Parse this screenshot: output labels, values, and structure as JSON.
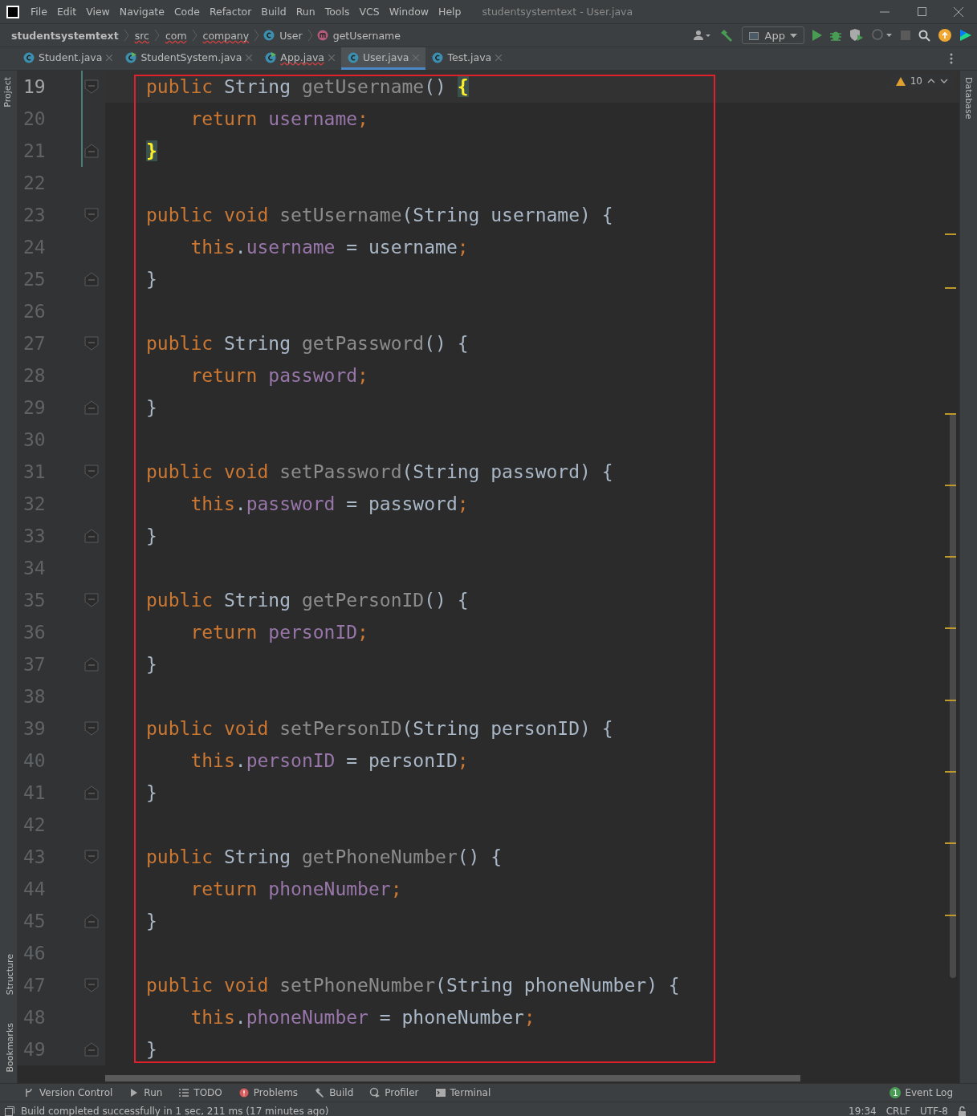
{
  "window": {
    "title": "studentsystemtext - User.java"
  },
  "menu": [
    "File",
    "Edit",
    "View",
    "Navigate",
    "Code",
    "Refactor",
    "Build",
    "Run",
    "Tools",
    "VCS",
    "Window",
    "Help"
  ],
  "breadcrumbs": [
    {
      "label": "studentsystemtext",
      "kind": "project",
      "spelling_error": false
    },
    {
      "label": "src",
      "kind": "folder",
      "spelling_error": true
    },
    {
      "label": "com",
      "kind": "folder",
      "spelling_error": true
    },
    {
      "label": "company",
      "kind": "folder",
      "spelling_error": true
    },
    {
      "label": "User",
      "kind": "class",
      "spelling_error": false
    },
    {
      "label": "getUsername",
      "kind": "method",
      "spelling_error": false
    }
  ],
  "run_config": "App",
  "tabs": [
    {
      "label": "Student.java",
      "runnable": false,
      "selected": false,
      "spelling_error": false
    },
    {
      "label": "StudentSystem.java",
      "runnable": true,
      "selected": false,
      "spelling_error": false
    },
    {
      "label": "App.java",
      "runnable": true,
      "selected": false,
      "spelling_error": true
    },
    {
      "label": "User.java",
      "runnable": false,
      "selected": true,
      "spelling_error": false
    },
    {
      "label": "Test.java",
      "runnable": false,
      "selected": false,
      "spelling_error": false
    }
  ],
  "left_tool_windows_top": [
    "Project"
  ],
  "left_tool_windows_bottom": [
    "Structure",
    "Bookmarks"
  ],
  "right_tool_windows": [
    "Database"
  ],
  "inspections": {
    "warnings": "10"
  },
  "editor": {
    "lines": [
      {
        "number": "19",
        "current": true,
        "changed": true,
        "kind": "fold-start",
        "tokens": [
          {
            "text": "public",
            "kind": "keyword"
          },
          {
            "text": " String ",
            "kind": "plain"
          },
          {
            "text": "getUsername",
            "kind": "unused"
          },
          {
            "text": "() ",
            "kind": "plain"
          },
          {
            "text": "{",
            "kind": "match"
          }
        ]
      },
      {
        "number": "20",
        "current": false,
        "changed": true,
        "kind": "body",
        "tokens": [
          {
            "text": "    return ",
            "kind": "keyword"
          },
          {
            "text": "username",
            "kind": "field"
          },
          {
            "text": ";",
            "kind": "keyword"
          }
        ]
      },
      {
        "number": "21",
        "current": false,
        "changed": true,
        "kind": "fold-end",
        "tokens": [
          {
            "text": "}",
            "kind": "match"
          }
        ]
      },
      {
        "number": "22",
        "current": false,
        "changed": false,
        "kind": "body"
      },
      {
        "number": "23",
        "current": false,
        "changed": false,
        "kind": "fold-start",
        "tokens": [
          {
            "text": "public void ",
            "kind": "keyword"
          },
          {
            "text": "setUsername",
            "kind": "unused"
          },
          {
            "text": "(String username) {",
            "kind": "plain"
          }
        ]
      },
      {
        "number": "24",
        "current": false,
        "changed": false,
        "kind": "body",
        "tokens": [
          {
            "text": "    this",
            "kind": "keyword"
          },
          {
            "text": ".",
            "kind": "plain"
          },
          {
            "text": "username",
            "kind": "field"
          },
          {
            "text": " = username",
            "kind": "plain"
          },
          {
            "text": ";",
            "kind": "keyword"
          }
        ]
      },
      {
        "number": "25",
        "current": false,
        "changed": false,
        "kind": "fold-end",
        "tokens": [
          {
            "text": "}",
            "kind": "plain"
          }
        ]
      },
      {
        "number": "26",
        "current": false,
        "changed": false,
        "kind": "body"
      },
      {
        "number": "27",
        "current": false,
        "changed": false,
        "kind": "fold-start",
        "tokens": [
          {
            "text": "public",
            "kind": "keyword"
          },
          {
            "text": " String ",
            "kind": "plain"
          },
          {
            "text": "getPassword",
            "kind": "unused"
          },
          {
            "text": "() {",
            "kind": "plain"
          }
        ]
      },
      {
        "number": "28",
        "current": false,
        "changed": false,
        "kind": "body",
        "tokens": [
          {
            "text": "    return ",
            "kind": "keyword"
          },
          {
            "text": "password",
            "kind": "field"
          },
          {
            "text": ";",
            "kind": "keyword"
          }
        ]
      },
      {
        "number": "29",
        "current": false,
        "changed": false,
        "kind": "fold-end",
        "tokens": [
          {
            "text": "}",
            "kind": "plain"
          }
        ]
      },
      {
        "number": "30",
        "current": false,
        "changed": false,
        "kind": "body"
      },
      {
        "number": "31",
        "current": false,
        "changed": false,
        "kind": "fold-start",
        "tokens": [
          {
            "text": "public void ",
            "kind": "keyword"
          },
          {
            "text": "setPassword",
            "kind": "unused"
          },
          {
            "text": "(String password) {",
            "kind": "plain"
          }
        ]
      },
      {
        "number": "32",
        "current": false,
        "changed": false,
        "kind": "body",
        "tokens": [
          {
            "text": "    this",
            "kind": "keyword"
          },
          {
            "text": ".",
            "kind": "plain"
          },
          {
            "text": "password",
            "kind": "field"
          },
          {
            "text": " = password",
            "kind": "plain"
          },
          {
            "text": ";",
            "kind": "keyword"
          }
        ]
      },
      {
        "number": "33",
        "current": false,
        "changed": false,
        "kind": "fold-end",
        "tokens": [
          {
            "text": "}",
            "kind": "plain"
          }
        ]
      },
      {
        "number": "34",
        "current": false,
        "changed": false,
        "kind": "body"
      },
      {
        "number": "35",
        "current": false,
        "changed": false,
        "kind": "fold-start",
        "tokens": [
          {
            "text": "public",
            "kind": "keyword"
          },
          {
            "text": " String ",
            "kind": "plain"
          },
          {
            "text": "getPersonID",
            "kind": "unused"
          },
          {
            "text": "() {",
            "kind": "plain"
          }
        ]
      },
      {
        "number": "36",
        "current": false,
        "changed": false,
        "kind": "body",
        "tokens": [
          {
            "text": "    return ",
            "kind": "keyword"
          },
          {
            "text": "personID",
            "kind": "field"
          },
          {
            "text": ";",
            "kind": "keyword"
          }
        ]
      },
      {
        "number": "37",
        "current": false,
        "changed": false,
        "kind": "fold-end",
        "tokens": [
          {
            "text": "}",
            "kind": "plain"
          }
        ]
      },
      {
        "number": "38",
        "current": false,
        "changed": false,
        "kind": "body"
      },
      {
        "number": "39",
        "current": false,
        "changed": false,
        "kind": "fold-start",
        "tokens": [
          {
            "text": "public void ",
            "kind": "keyword"
          },
          {
            "text": "setPersonID",
            "kind": "unused"
          },
          {
            "text": "(String personID) {",
            "kind": "plain"
          }
        ]
      },
      {
        "number": "40",
        "current": false,
        "changed": false,
        "kind": "body",
        "tokens": [
          {
            "text": "    this",
            "kind": "keyword"
          },
          {
            "text": ".",
            "kind": "plain"
          },
          {
            "text": "personID",
            "kind": "field"
          },
          {
            "text": " = personID",
            "kind": "plain"
          },
          {
            "text": ";",
            "kind": "keyword"
          }
        ]
      },
      {
        "number": "41",
        "current": false,
        "changed": false,
        "kind": "fold-end",
        "tokens": [
          {
            "text": "}",
            "kind": "plain"
          }
        ]
      },
      {
        "number": "42",
        "current": false,
        "changed": false,
        "kind": "body"
      },
      {
        "number": "43",
        "current": false,
        "changed": false,
        "kind": "fold-start",
        "tokens": [
          {
            "text": "public",
            "kind": "keyword"
          },
          {
            "text": " String ",
            "kind": "plain"
          },
          {
            "text": "getPhoneNumber",
            "kind": "unused"
          },
          {
            "text": "() {",
            "kind": "plain"
          }
        ]
      },
      {
        "number": "44",
        "current": false,
        "changed": false,
        "kind": "body",
        "tokens": [
          {
            "text": "    return ",
            "kind": "keyword"
          },
          {
            "text": "phoneNumber",
            "kind": "field"
          },
          {
            "text": ";",
            "kind": "keyword"
          }
        ]
      },
      {
        "number": "45",
        "current": false,
        "changed": false,
        "kind": "fold-end",
        "tokens": [
          {
            "text": "}",
            "kind": "plain"
          }
        ]
      },
      {
        "number": "46",
        "current": false,
        "changed": false,
        "kind": "body"
      },
      {
        "number": "47",
        "current": false,
        "changed": false,
        "kind": "fold-start",
        "tokens": [
          {
            "text": "public void ",
            "kind": "keyword"
          },
          {
            "text": "setPhoneNumber",
            "kind": "unused"
          },
          {
            "text": "(String phoneNumber) {",
            "kind": "plain"
          }
        ]
      },
      {
        "number": "48",
        "current": false,
        "changed": false,
        "kind": "body",
        "tokens": [
          {
            "text": "    this",
            "kind": "keyword"
          },
          {
            "text": ".",
            "kind": "plain"
          },
          {
            "text": "phoneNumber",
            "kind": "field"
          },
          {
            "text": " = phoneNumber",
            "kind": "plain"
          },
          {
            "text": ";",
            "kind": "keyword"
          }
        ]
      },
      {
        "number": "49",
        "current": false,
        "changed": false,
        "kind": "fold-end",
        "tokens": [
          {
            "text": "}",
            "kind": "plain"
          }
        ]
      }
    ]
  },
  "tool_windows": [
    {
      "label": "Version Control",
      "kind": "vcs"
    },
    {
      "label": "Run",
      "kind": "run"
    },
    {
      "label": "TODO",
      "kind": "todo"
    },
    {
      "label": "Problems",
      "kind": "problems"
    },
    {
      "label": "Build",
      "kind": "build"
    },
    {
      "label": "Profiler",
      "kind": "profiler"
    },
    {
      "label": "Terminal",
      "kind": "terminal"
    }
  ],
  "event_log": {
    "label": "Event Log",
    "badge": "1"
  },
  "status_bar": {
    "message": "Build completed successfully in 1 sec, 211 ms (17 minutes ago)",
    "position": "19:34",
    "line_separator": "CRLF",
    "encoding": "UTF-8"
  }
}
